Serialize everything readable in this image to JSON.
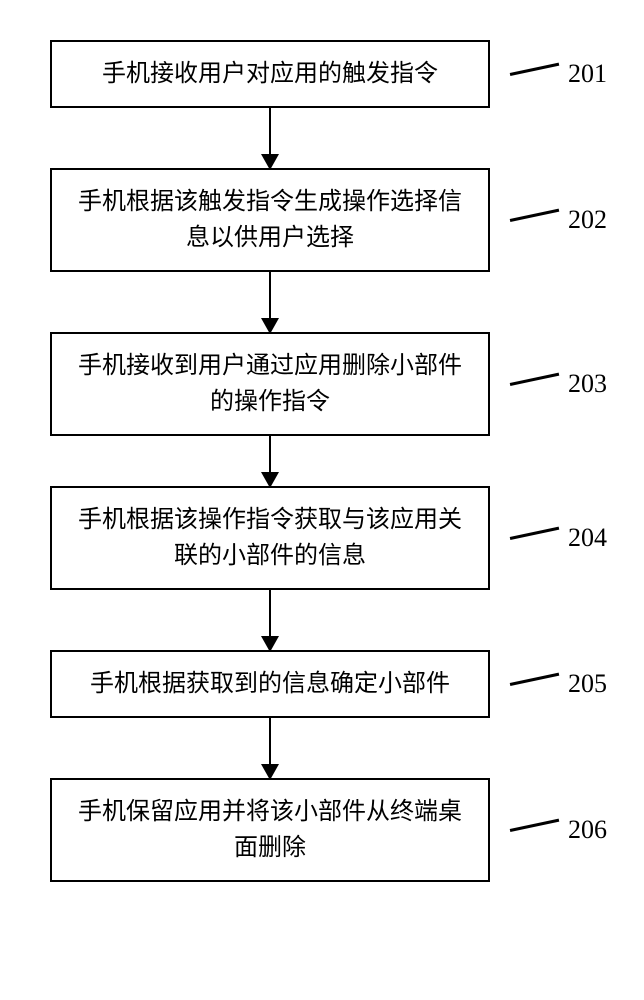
{
  "flowchart": {
    "steps": [
      {
        "label": "201",
        "text": "手机接收用户对应用的触发指令"
      },
      {
        "label": "202",
        "text": "手机根据该触发指令生成操作选择信息以供用户选择"
      },
      {
        "label": "203",
        "text": "手机接收到用户通过应用删除小部件的操作指令"
      },
      {
        "label": "204",
        "text": "手机根据该操作指令获取与该应用关联的小部件的信息"
      },
      {
        "label": "205",
        "text": "手机根据获取到的信息确定小部件"
      },
      {
        "label": "206",
        "text": "手机保留应用并将该小部件从终端桌面删除"
      }
    ]
  }
}
